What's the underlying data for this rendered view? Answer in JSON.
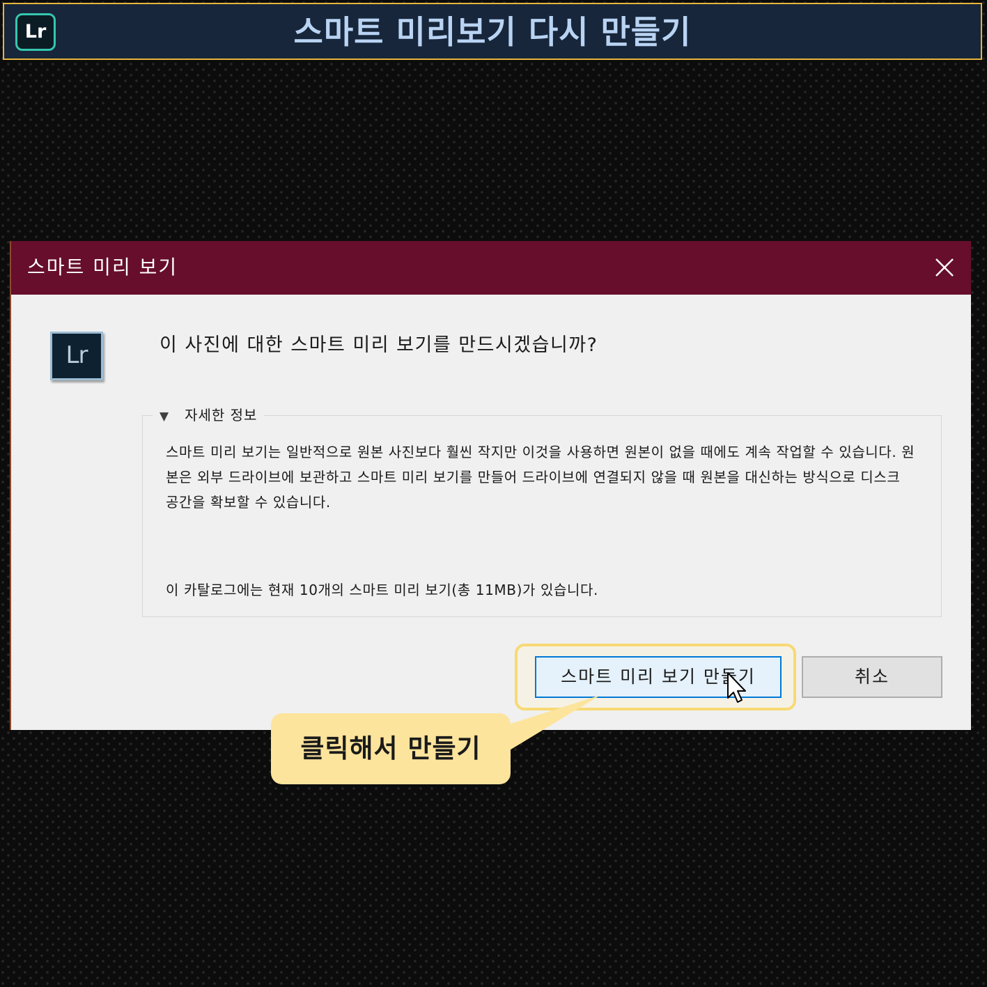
{
  "banner": {
    "logo_text": "Lr",
    "title": "스마트 미리보기 다시 만들기"
  },
  "dialog": {
    "title": "스마트 미리 보기",
    "icon_text": "Lr",
    "question": "이 사진에 대한 스마트 미리 보기를 만드시겠습니까?",
    "details": {
      "legend": "자세한 정보",
      "body": "스마트 미리 보기는 일반적으로 원본 사진보다 훨씬 작지만 이것을 사용하면 원본이 없을 때에도 계속 작업할 수 있습니다. 원본은 외부 드라이브에 보관하고 스마트 미리 보기를 만들어 드라이브에 연결되지 않을 때 원본을 대신하는 방식으로 디스크 공간을 확보할 수 있습니다.",
      "summary": "이 카탈로그에는 현재 10개의 스마트 미리 보기(총 11MB)가 있습니다."
    },
    "buttons": {
      "create": "스마트 미리 보기 만들기",
      "cancel": "취소"
    }
  },
  "callout": {
    "text": "클릭해서 만들기"
  },
  "colors": {
    "titlebar": "#660e2c",
    "banner_bg": "#17263a",
    "banner_border": "#e8b53c",
    "banner_title": "#b9d3f3",
    "highlight": "#f8d974",
    "callout_bg": "#fde49c",
    "primary_button_border": "#0078d7"
  },
  "icons": {
    "close": "close-icon",
    "expand": "triangle-down-icon",
    "cursor": "mouse-pointer-icon",
    "app": "lightroom-icon"
  }
}
